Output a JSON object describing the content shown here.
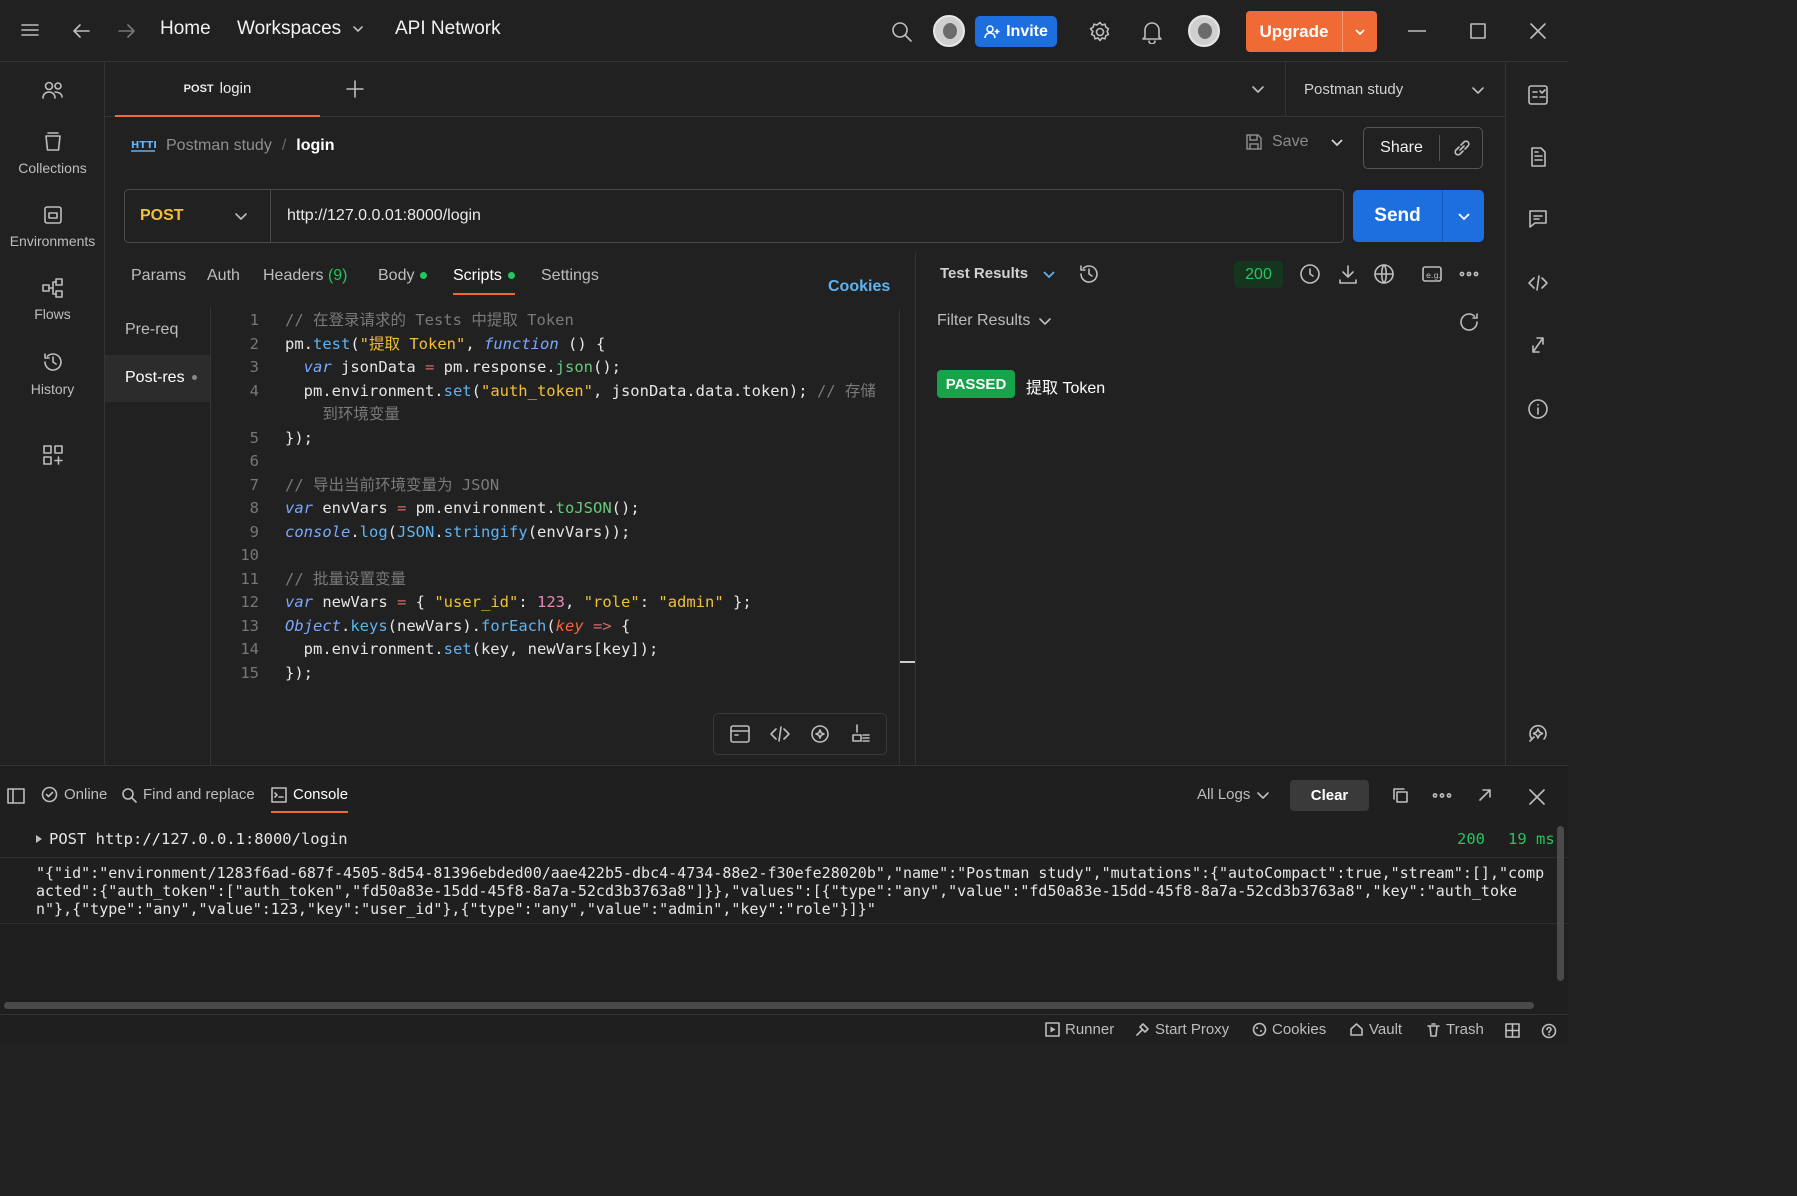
{
  "topbar": {
    "home": "Home",
    "workspaces": "Workspaces",
    "api_network": "API Network",
    "invite": "Invite",
    "upgrade": "Upgrade"
  },
  "sidebar": [
    {
      "label": "Collections"
    },
    {
      "label": "Environments"
    },
    {
      "label": "Flows"
    },
    {
      "label": "History"
    }
  ],
  "tab": {
    "method": "POST",
    "name": "login"
  },
  "environment": "Postman study",
  "breadcrumb": {
    "collection": "Postman study",
    "sep": "/",
    "request": "login"
  },
  "actions": {
    "save": "Save",
    "share": "Share",
    "send": "Send"
  },
  "request": {
    "method": "POST",
    "url": "http://127.0.0.01:8000/login"
  },
  "req_tabs": {
    "params": "Params",
    "auth": "Auth",
    "headers": "Headers",
    "headers_count": "(9)",
    "body": "Body",
    "scripts": "Scripts",
    "settings": "Settings",
    "cookies": "Cookies"
  },
  "script_tabs": {
    "pre": "Pre-req",
    "post": "Post-res"
  },
  "code_lines": [
    "1",
    "2",
    "3",
    "4",
    "5",
    "6",
    "7",
    "8",
    "9",
    "10",
    "11",
    "12",
    "13",
    "14",
    "15"
  ],
  "response": {
    "title": "Test Results",
    "status": "200",
    "filter": "Filter Results",
    "result_badge": "PASSED",
    "result_name": "提取 Token"
  },
  "console": {
    "online": "Online",
    "find": "Find and replace",
    "console": "Console",
    "logs": "All Logs",
    "clear": "Clear",
    "request_line": "POST http://127.0.0.1:8000/login",
    "status": "200",
    "time": "19 ms",
    "output": "\"{\"id\":\"environment/1283f6ad-687f-4505-8d54-81396ebded00/aae422b5-dbc4-4734-88e2-f30efe28020b\",\"name\":\"Postman study\",\"mutations\":{\"autoCompact\":true,\"stream\":[],\"compacted\":{\"auth_token\":[\"auth_token\",\"fd50a83e-15dd-45f8-8a7a-52cd3b3763a8\"]}},\"values\":[{\"type\":\"any\",\"value\":\"fd50a83e-15dd-45f8-8a7a-52cd3b3763a8\",\"key\":\"auth_token\"},{\"type\":\"any\",\"value\":123,\"key\":\"user_id\"},{\"type\":\"any\",\"value\":\"admin\",\"key\":\"role\"}]}\""
  },
  "statusbar": {
    "runner": "Runner",
    "proxy": "Start Proxy",
    "cookies": "Cookies",
    "vault": "Vault",
    "trash": "Trash"
  },
  "colors": {
    "accent": "#ef6a34",
    "send": "#1d6fe0",
    "passed": "#16a34a",
    "status_ok": "#22c55e",
    "method_post": "#f2c035"
  }
}
